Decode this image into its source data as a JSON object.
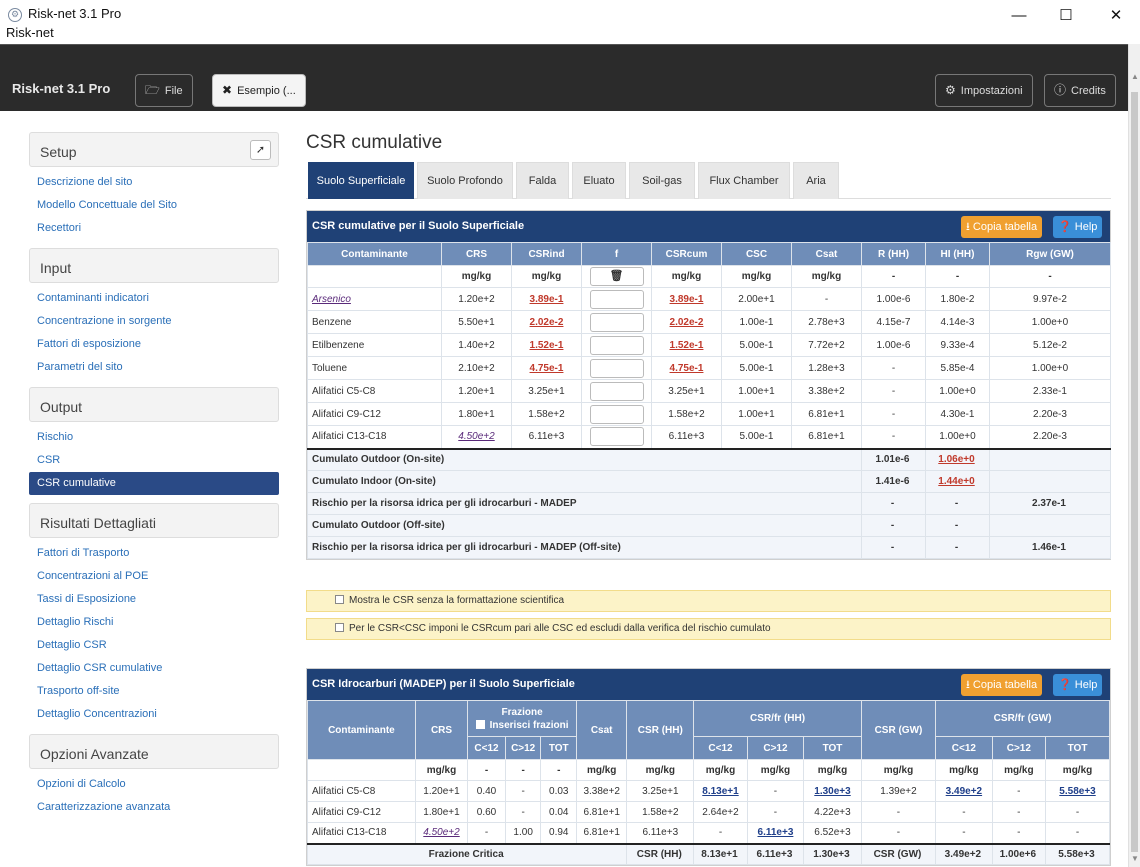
{
  "window": {
    "title": "Risk-net 3.1 Pro",
    "menu_title": "Risk-net",
    "icon_glyph": "⚙",
    "minimize": "—",
    "maximize": "☐",
    "close": "✕"
  },
  "navbar": {
    "brand": "Risk-net 3.1 Pro",
    "file_label": "File",
    "file_icon": "folder-open-icon",
    "example_label": "Esempio (...",
    "example_icon": "close-circle-icon",
    "settings_label": "Impostazioni",
    "settings_icon": "gear-icon",
    "credits_label": "Credits",
    "credits_icon": "info-icon"
  },
  "sidebar": {
    "sections": [
      {
        "title": "Setup",
        "items": [
          "Descrizione del sito",
          "Modello Concettuale del Sito",
          "Recettori"
        ]
      },
      {
        "title": "Input",
        "items": [
          "Contaminanti indicatori",
          "Concentrazione in sorgente",
          "Fattori di esposizione",
          "Parametri del sito"
        ]
      },
      {
        "title": "Output",
        "items": [
          "Rischio",
          "CSR",
          "CSR cumulative"
        ]
      },
      {
        "title": "Risultati Dettagliati",
        "items": [
          "Fattori di Trasporto",
          "Concentrazioni al POE",
          "Tassi di Esposizione",
          "Dettaglio Rischi",
          "Dettaglio CSR",
          "Dettaglio CSR cumulative",
          "Trasporto off-site",
          "Dettaglio Concentrazioni"
        ]
      },
      {
        "title": "Opzioni Avanzate",
        "items": [
          "Opzioni di Calcolo",
          "Caratterizzazione avanzata"
        ]
      }
    ],
    "active_item": "CSR cumulative"
  },
  "main": {
    "title": "CSR cumulative",
    "tabs": [
      "Suolo Superficiale",
      "Suolo Profondo",
      "Falda",
      "Eluato",
      "Soil-gas",
      "Flux Chamber",
      "Aria"
    ],
    "active_tab": "Suolo Superficiale"
  },
  "table1": {
    "title": "CSR cumulative per il Suolo Superficiale",
    "copy_label": "Copia tabella",
    "help_label": "Help",
    "headers": [
      "Contaminante",
      "CRS",
      "CSRind",
      "f",
      "CSRcum",
      "CSC",
      "Csat",
      "R (HH)",
      "HI (HH)",
      "Rgw (GW)"
    ],
    "units": [
      "",
      "mg/kg",
      "mg/kg",
      "",
      "mg/kg",
      "mg/kg",
      "mg/kg",
      "-",
      "-",
      "-"
    ],
    "trash_icon": "trash-icon",
    "rows": [
      {
        "name": "Arsenico",
        "crs": "1.20e+2",
        "csrind": "3.89e-1",
        "csrcum": "3.89e-1",
        "csc": "2.00e+1",
        "csat": "-",
        "r": "1.00e-6",
        "hi": "1.80e-2",
        "rgw": "9.97e-2"
      },
      {
        "name": "Benzene",
        "crs": "5.50e+1",
        "csrind": "2.02e-2",
        "csrcum": "2.02e-2",
        "csc": "1.00e-1",
        "csat": "2.78e+3",
        "r": "4.15e-7",
        "hi": "4.14e-3",
        "rgw": "1.00e+0"
      },
      {
        "name": "Etilbenzene",
        "crs": "1.40e+2",
        "csrind": "1.52e-1",
        "csrcum": "1.52e-1",
        "csc": "5.00e-1",
        "csat": "7.72e+2",
        "r": "1.00e-6",
        "hi": "9.33e-4",
        "rgw": "5.12e-2"
      },
      {
        "name": "Toluene",
        "crs": "2.10e+2",
        "csrind": "4.75e-1",
        "csrcum": "4.75e-1",
        "csc": "5.00e-1",
        "csat": "1.28e+3",
        "r": "-",
        "hi": "5.85e-4",
        "rgw": "1.00e+0"
      },
      {
        "name": "Alifatici C5-C8",
        "crs": "1.20e+1",
        "csrind": "3.25e+1",
        "csrcum": "3.25e+1",
        "csc": "1.00e+1",
        "csat": "3.38e+2",
        "r": "-",
        "hi": "1.00e+0",
        "rgw": "2.33e-1"
      },
      {
        "name": "Alifatici C9-C12",
        "crs": "1.80e+1",
        "csrind": "1.58e+2",
        "csrcum": "1.58e+2",
        "csc": "1.00e+1",
        "csat": "6.81e+1",
        "r": "-",
        "hi": "4.30e-1",
        "rgw": "2.20e-3"
      },
      {
        "name": "Alifatici C13-C18",
        "crs": "4.50e+2",
        "csrind": "6.11e+3",
        "csrcum": "6.11e+3",
        "csc": "5.00e-1",
        "csat": "6.81e+1",
        "r": "-",
        "hi": "1.00e+0",
        "rgw": "2.20e-3"
      }
    ],
    "summary": [
      {
        "label": "Cumulato Outdoor (On-site)",
        "r": "1.01e-6",
        "hi": "1.06e+0",
        "rgw": ""
      },
      {
        "label": "Cumulato Indoor (On-site)",
        "r": "1.41e-6",
        "hi": "1.44e+0",
        "rgw": ""
      },
      {
        "label": "Rischio per la risorsa idrica per gli idrocarburi - MADEP",
        "r": "-",
        "hi": "-",
        "rgw": "2.37e-1"
      },
      {
        "label": "Cumulato Outdoor (Off-site)",
        "r": "-",
        "hi": "-",
        "rgw": ""
      },
      {
        "label": "Rischio per la risorsa idrica per gli idrocarburi - MADEP (Off-site)",
        "r": "-",
        "hi": "-",
        "rgw": "1.46e-1"
      }
    ]
  },
  "notices": [
    "Mostra le CSR senza la formattazione scientifica",
    "Per le CSR<CSC imponi le CSRcum pari alle CSC ed escludi dalla verifica del rischio cumulato"
  ],
  "table2": {
    "title": "CSR Idrocarburi (MADEP) per il Suolo Superficiale",
    "copy_label": "Copia tabella",
    "help_label": "Help",
    "h_contaminante": "Contaminante",
    "h_crs": "CRS",
    "h_frazione": "Frazione",
    "h_inserisci": "Inserisci frazioni",
    "h_csat": "Csat",
    "h_csr_hh": "CSR (HH)",
    "h_csrfr_hh": "CSR/fr (HH)",
    "h_csr_gw": "CSR (GW)",
    "h_csrfr_gw": "CSR/fr (GW)",
    "sub": [
      "C<12",
      "C>12",
      "TOT"
    ],
    "units": [
      "mg/kg",
      "-",
      "-",
      "-",
      "mg/kg",
      "mg/kg",
      "mg/kg",
      "mg/kg",
      "mg/kg",
      "mg/kg",
      "mg/kg",
      "mg/kg",
      "mg/kg"
    ],
    "rows": [
      {
        "name": "Alifatici C5-C8",
        "crs": "1.20e+1",
        "f1": "0.40",
        "f2": "-",
        "ft": "0.03",
        "csat": "3.38e+2",
        "csrhh": "3.25e+1",
        "h1": "8.13e+1",
        "h2": "-",
        "ht": "1.30e+3",
        "csrgw": "1.39e+2",
        "g1": "3.49e+2",
        "g2": "-",
        "gt": "5.58e+3"
      },
      {
        "name": "Alifatici C9-C12",
        "crs": "1.80e+1",
        "f1": "0.60",
        "f2": "-",
        "ft": "0.04",
        "csat": "6.81e+1",
        "csrhh": "1.58e+2",
        "h1": "2.64e+2",
        "h2": "-",
        "ht": "4.22e+3",
        "csrgw": "-",
        "g1": "-",
        "g2": "-",
        "gt": "-"
      },
      {
        "name": "Alifatici C13-C18",
        "crs": "4.50e+2",
        "f1": "-",
        "f2": "1.00",
        "ft": "0.94",
        "csat": "6.81e+1",
        "csrhh": "6.11e+3",
        "h1": "-",
        "h2": "6.11e+3",
        "ht": "6.52e+3",
        "csrgw": "-",
        "g1": "-",
        "g2": "-",
        "gt": "-"
      }
    ],
    "footer": {
      "label": "Frazione Critica",
      "csrhh": "CSR (HH)",
      "h1": "8.13e+1",
      "h2": "6.11e+3",
      "ht": "1.30e+3",
      "csrgw": "CSR (GW)",
      "g1": "3.49e+2",
      "g2": "1.00e+6",
      "gt": "5.58e+3"
    }
  }
}
